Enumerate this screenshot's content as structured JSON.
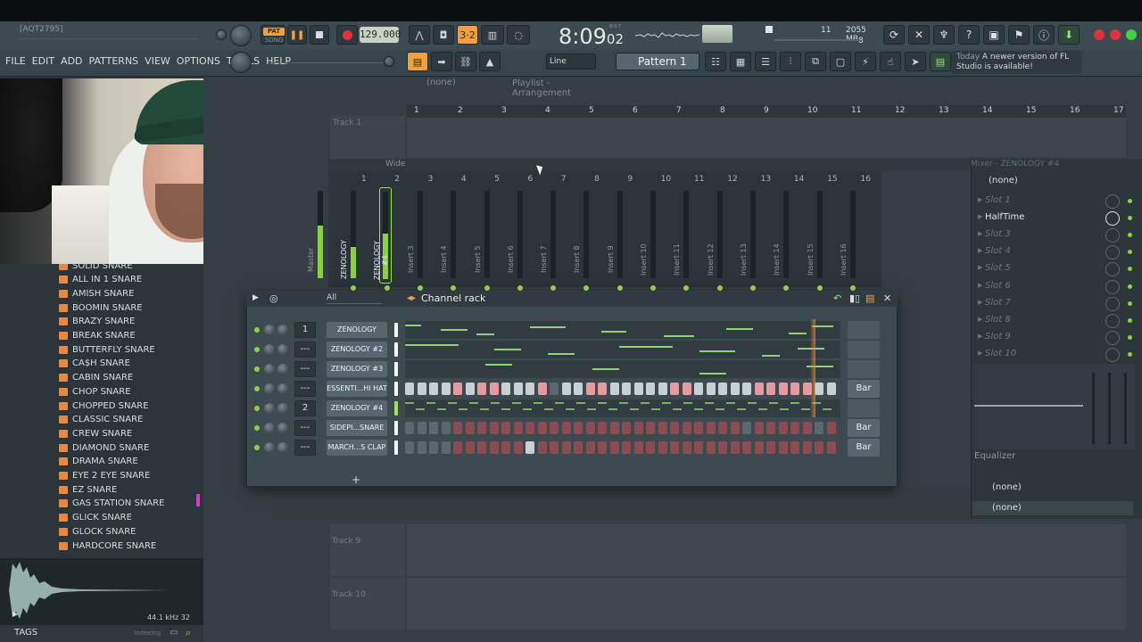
{
  "app": {
    "project_name": "[AQT2795]",
    "menu": [
      "FILE",
      "EDIT",
      "ADD",
      "PATTERNS",
      "VIEW",
      "OPTIONS",
      "TOOLS",
      "HELP"
    ],
    "transport": {
      "pat_label": "PAT",
      "song_label": "SONG",
      "tempo": "129.000",
      "time_main": "8:09",
      "time_sub": "02",
      "time_mode": "B:S:T",
      "cpu_a": "11",
      "ram": "2055 MB",
      "cpu_b": "8"
    },
    "toolbar": {
      "snap": "Line",
      "pattern": "Pattern 1"
    },
    "news": {
      "today": "Today",
      "message": "A newer version of FL Studio is available!"
    },
    "accent_color": "#f0a23a",
    "active_green": "#8fd04a"
  },
  "browser": {
    "items": [
      "SOLID SNARE",
      "ALL IN 1 SNARE",
      "AMISH SNARE",
      "BOOMIN SNARE",
      "BRAZY SNARE",
      "BREAK SNARE",
      "BUTTERFLY SNARE",
      "CA$H SNARE",
      "CABIN SNARE",
      "CHOP SNARE",
      "CHOPPED SNARE",
      "CLASSIC SNARE",
      "CREW SNARE",
      "DIAMOND SNARE",
      "DRAMA SNARE",
      "EYE 2 EYE SNARE",
      "EZ SNARE",
      "GAS STATION SNARE",
      "GLICK SNARE",
      "GLOCK SNARE",
      "HARDCORE SNARE"
    ],
    "sample_info": "44.1 kHz 32",
    "tags_label": "TAGS",
    "indexing_label": "Indexing"
  },
  "playlist": {
    "title": "Playlist - Arrangement",
    "pattern": "(none)",
    "bars": [
      "1",
      "2",
      "3",
      "4",
      "5",
      "6",
      "7",
      "8",
      "9",
      "10",
      "11",
      "12",
      "13",
      "14",
      "15",
      "16",
      "17"
    ],
    "tracks": [
      "Track 1",
      "Track 9",
      "Track 10"
    ]
  },
  "mixer": {
    "title": "Mixer - ZENOLOGY #4",
    "view_mode": "Wide",
    "numbers": [
      "1",
      "2",
      "3",
      "4",
      "5",
      "6",
      "7",
      "8",
      "9",
      "10",
      "11",
      "12",
      "13",
      "14",
      "15",
      "16"
    ],
    "inserts": [
      "Master",
      "ZENOLOGY",
      "ZENOLOGY #4",
      "Insert 3",
      "Insert 4",
      "Insert 5",
      "Insert 6",
      "Insert 7",
      "Insert 8",
      "Insert 9",
      "Insert 10",
      "Insert 11",
      "Insert 12",
      "Insert 13",
      "Insert 14",
      "Insert 15",
      "Insert 16"
    ],
    "preset": "(none)",
    "slots": [
      "Slot 1",
      "HalfTime",
      "Slot 3",
      "Slot 4",
      "Slot 5",
      "Slot 6",
      "Slot 7",
      "Slot 8",
      "Slot 9",
      "Slot 10"
    ],
    "equalizer_label": "Equalizer",
    "out_a": "(none)",
    "out_b": "(none)"
  },
  "channel_rack": {
    "title": "Channel rack",
    "filter": "All",
    "channels": [
      {
        "num": "1",
        "name": "ZENOLOGY",
        "mode": "roll",
        "bar": ""
      },
      {
        "num": "---",
        "name": "ZENOLOGY #2",
        "mode": "roll",
        "bar": ""
      },
      {
        "num": "---",
        "name": "ZENOLOGY #3",
        "mode": "roll",
        "bar": ""
      },
      {
        "num": "---",
        "name": "ESSENTI...HI HAT",
        "mode": "steps",
        "bar": "Bar",
        "steps": [
          1,
          1,
          1,
          1,
          2,
          1,
          2,
          2,
          1,
          1,
          1,
          2,
          0,
          1,
          1,
          2,
          2,
          1,
          1,
          1,
          1,
          1,
          2,
          2,
          1,
          1,
          1,
          1,
          1,
          2,
          2,
          2,
          2,
          2,
          1,
          1,
          0,
          1,
          1,
          1,
          1,
          1,
          2,
          2,
          2,
          2,
          2,
          2,
          2,
          0,
          0,
          0,
          0
        ]
      },
      {
        "num": "2",
        "name": "ZENOLOGY #4",
        "mode": "roll",
        "bar": ""
      },
      {
        "num": "---",
        "name": "SIDEPI...SNARE",
        "mode": "steps",
        "bar": "Bar",
        "steps": [
          0,
          0,
          0,
          0,
          3,
          3,
          3,
          3,
          3,
          3,
          3,
          3,
          3,
          3,
          3,
          3,
          3,
          3,
          3,
          3,
          3,
          3,
          3,
          3,
          3,
          3,
          3,
          3,
          0,
          3,
          3,
          3,
          3,
          3,
          0,
          3,
          3,
          3,
          3,
          3,
          3,
          3,
          3,
          3,
          3,
          3,
          3,
          3,
          3,
          3,
          3,
          4,
          4,
          3,
          3,
          3
        ]
      },
      {
        "num": "---",
        "name": "MARCH...S CLAP",
        "mode": "steps",
        "bar": "Bar",
        "steps": [
          0,
          0,
          0,
          0,
          3,
          3,
          3,
          3,
          3,
          3,
          1,
          3,
          3,
          3,
          3,
          3,
          3,
          3,
          3,
          3,
          3,
          3,
          3,
          3,
          3,
          3,
          3,
          3,
          3,
          3,
          3,
          3,
          3,
          3,
          3,
          3,
          3,
          3,
          3,
          3,
          3,
          3,
          3,
          3,
          3,
          3,
          1,
          3,
          3,
          3,
          3,
          3,
          3,
          3,
          3,
          0
        ]
      }
    ]
  }
}
